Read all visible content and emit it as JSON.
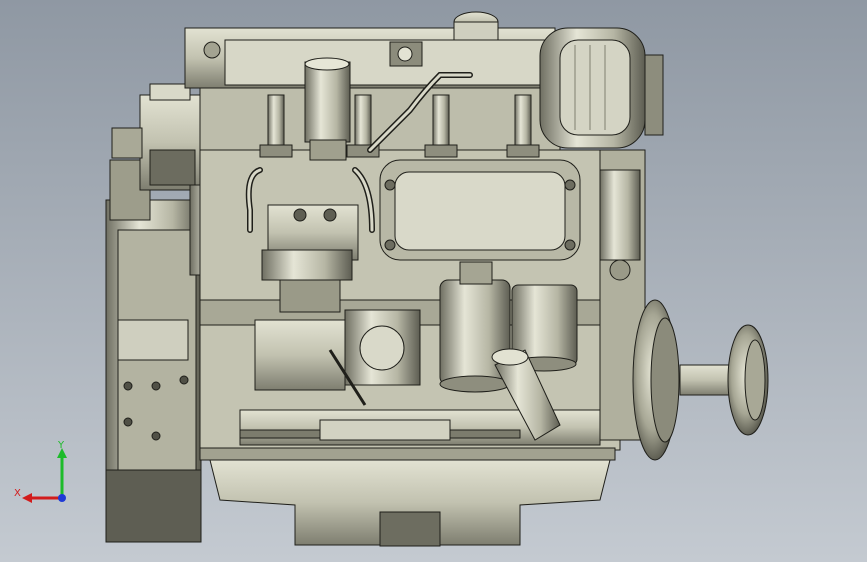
{
  "viewport": {
    "background_top": "#8f98a3",
    "background_bottom": "#c4cad1"
  },
  "model": {
    "body_color": "#c9c9b7",
    "shade_color": "#8c8c7c",
    "dark_color": "#4d4d44",
    "edge_color": "#1f1f1a"
  },
  "triad": {
    "x_label": "X",
    "y_label": "Y",
    "x_color": "#d21c1c",
    "y_color": "#1dbb2a",
    "z_color": "#1f3ad6"
  }
}
